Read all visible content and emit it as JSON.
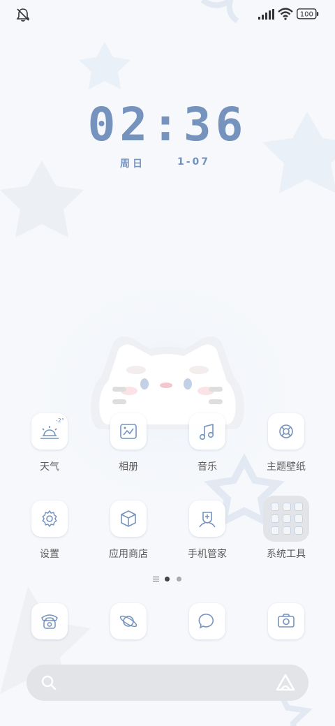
{
  "status_bar": {
    "left_icon": "bell-off-icon",
    "signal_icon": "signal-icon",
    "wifi_icon": "wifi-icon",
    "battery_level": "100"
  },
  "clock": {
    "time": "02:36",
    "weekday": "周日",
    "date": "1-07"
  },
  "apps_row1": [
    {
      "label": "天气",
      "icon": "weather-sunrise-icon",
      "badge": "-2°"
    },
    {
      "label": "相册",
      "icon": "gallery-icon"
    },
    {
      "label": "音乐",
      "icon": "music-note-icon"
    },
    {
      "label": "主题壁纸",
      "icon": "theme-lifebuoy-icon"
    }
  ],
  "apps_row2": [
    {
      "label": "设置",
      "icon": "gear-icon"
    },
    {
      "label": "应用商店",
      "icon": "app-store-box-icon"
    },
    {
      "label": "手机管家",
      "icon": "phone-manager-icon"
    },
    {
      "label": "系统工具",
      "icon": "folder-icon"
    }
  ],
  "page_indicator": {
    "pages": 2,
    "current": 1
  },
  "dock": [
    {
      "icon": "phone-icon"
    },
    {
      "icon": "browser-planet-icon"
    },
    {
      "icon": "message-bubble-icon"
    },
    {
      "icon": "camera-icon"
    }
  ],
  "search": {
    "placeholder": "",
    "left_icon": "search-icon",
    "right_icon": "assistant-icon"
  },
  "colors": {
    "accent": "#7593bd",
    "label": "#5b5b5b",
    "background": "#f6f8fb"
  }
}
